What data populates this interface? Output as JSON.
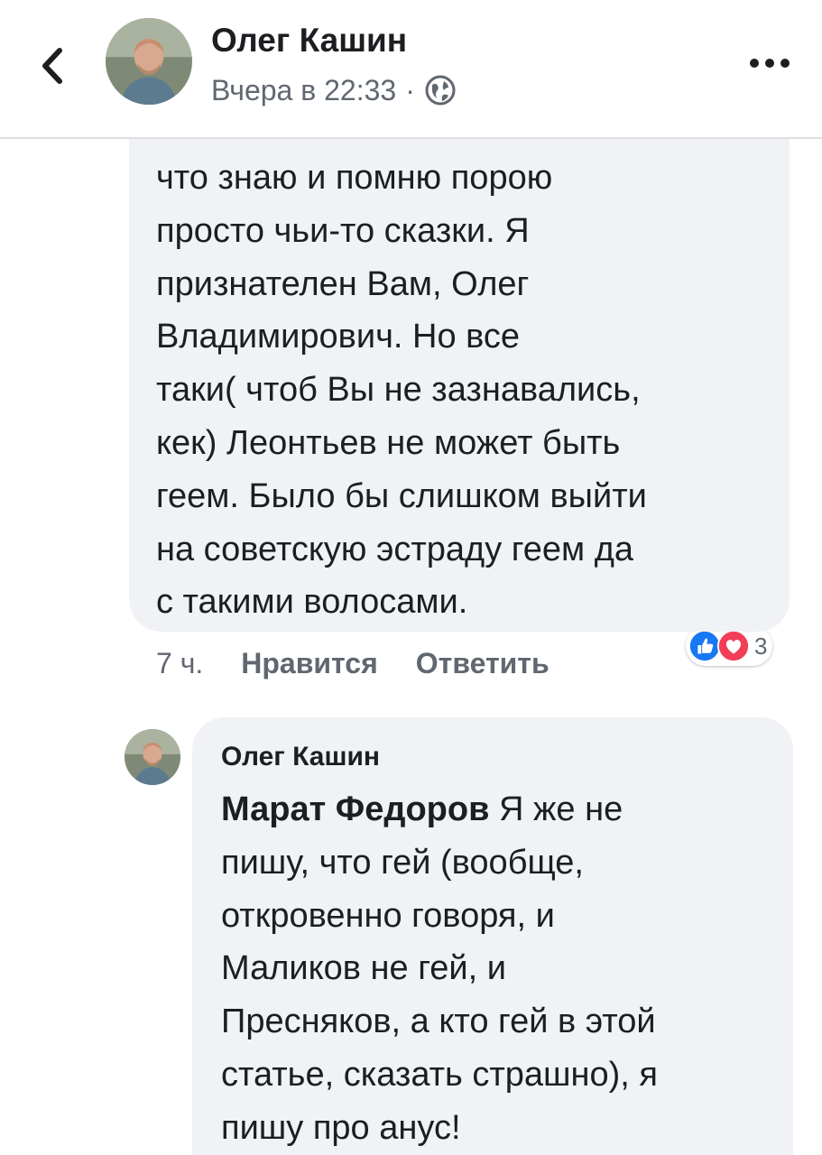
{
  "header": {
    "author_name": "Олег Кашин",
    "timestamp": "Вчера в 22:33",
    "separator": "·",
    "back_icon": "chevron-left-icon",
    "privacy_icon": "globe-icon",
    "more_icon": "more-horizontal-icon"
  },
  "comment": {
    "lines": [
      "что знаю и помню порою",
      "просто чьи-то сказки. Я",
      "признателен Вам, Олег",
      "Владимирович. Но все",
      "таки( чтоб Вы не зазнавались,",
      "кек) Леонтьев не может быть",
      "геем. Было бы слишком выйти",
      "на советскую эстраду геем да",
      "с такими волосами."
    ],
    "time": "7 ч.",
    "like_label": "Нравится",
    "reply_label": "Ответить",
    "reactions": {
      "icons": [
        "like-icon",
        "love-icon"
      ],
      "count": "3"
    }
  },
  "reply": {
    "author_name": "Олег Кашин",
    "mention": "Марат Федоров",
    "first_line_rest": " Я же не",
    "lines": [
      "пишу, что гей (вообще,",
      "откровенно говоря, и",
      "Маликов не гей, и",
      "Пресняков, а кто гей в этой",
      "статье, сказать страшно), я",
      "пишу про анус!"
    ]
  },
  "colors": {
    "bubble": "#f0f2f5",
    "text": "#1c1e21",
    "meta": "#606770",
    "like_blue": "#1877f2",
    "love_red": "#f33e58"
  }
}
